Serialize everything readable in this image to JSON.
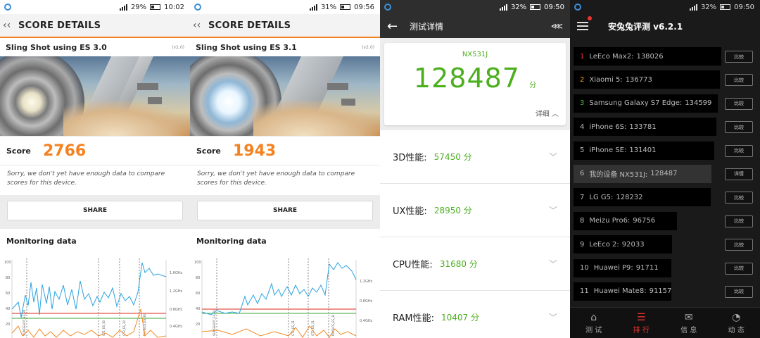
{
  "screen1": {
    "status": {
      "battery": "29%",
      "time": "10:02"
    },
    "title": "SCORE DETAILS",
    "test_name": "Sling Shot using ES 3.0",
    "version": "(v2.0)",
    "score_label": "Score",
    "score": "2766",
    "note": "Sorry, we don't yet have enough data to compare scores for this device.",
    "share": "SHARE",
    "monitoring": "Monitoring data",
    "chart_labels": {
      "y": [
        "100",
        "80",
        "60",
        "40",
        "20"
      ],
      "freq": [
        "1.6GHz",
        "1.2GHz",
        "0.8GHz",
        "0.4GHz"
      ],
      "markers": [
        "SLINGSHOT_ES_30",
        "GT1_ES_30",
        "GT2_ES_30",
        "PHYSICS_ES_30"
      ]
    }
  },
  "screen2": {
    "status": {
      "battery": "31%",
      "time": "09:56"
    },
    "title": "SCORE DETAILS",
    "test_name": "Sling Shot using ES 3.1",
    "version": "(v2.0)",
    "score_label": "Score",
    "score": "1943",
    "note": "Sorry, we don't yet have enough data to compare scores for this device.",
    "share": "SHARE",
    "monitoring": "Monitoring data",
    "chart_labels": {
      "y": [
        "100",
        "80",
        "60",
        "40",
        "20"
      ],
      "freq": [
        "1.2GHz",
        "0.8GHz",
        "0.4GHz"
      ],
      "markers": [
        "SLINGSHOT_ES_31",
        "GT1_ES_31",
        "GT2_ES_31",
        "PHYSICS_ES_31"
      ]
    }
  },
  "screen3": {
    "status": {
      "battery": "32%",
      "time": "09:50"
    },
    "title": "测试详情",
    "device": "NX531J",
    "total": "128487",
    "unit": "分",
    "more": "详细",
    "rows": [
      {
        "label": "3D性能:",
        "value": "57450 分"
      },
      {
        "label": "UX性能:",
        "value": "28950 分"
      },
      {
        "label": "CPU性能:",
        "value": "31680 分"
      },
      {
        "label": "RAM性能:",
        "value": "10407 分"
      }
    ]
  },
  "screen4": {
    "status": {
      "battery": "32%",
      "time": "09:50"
    },
    "title": "安兔兔评测 v6.2.1",
    "compare": "比较",
    "detail": "详情",
    "items": [
      {
        "rank": "1",
        "name": "LeEco Max2:",
        "score": "138026",
        "fraction": 1.0,
        "mine": false
      },
      {
        "rank": "2",
        "name": "Xiaomi 5:",
        "score": "136773",
        "fraction": 0.99,
        "mine": false
      },
      {
        "rank": "3",
        "name": "Samsung Galaxy S7 Edge:",
        "score": "134599",
        "fraction": 0.975,
        "mine": false
      },
      {
        "rank": "4",
        "name": "iPhone 6S:",
        "score": "133781",
        "fraction": 0.969,
        "mine": false
      },
      {
        "rank": "5",
        "name": "iPhone SE:",
        "score": "131401",
        "fraction": 0.952,
        "mine": false
      },
      {
        "rank": "6",
        "name": "我的设备 NX531J:",
        "score": "128487",
        "fraction": 0.931,
        "mine": true
      },
      {
        "rank": "7",
        "name": "LG G5:",
        "score": "128232",
        "fraction": 0.929,
        "mine": false
      },
      {
        "rank": "8",
        "name": "Meizu Pro6:",
        "score": "96756",
        "fraction": 0.701,
        "mine": false
      },
      {
        "rank": "9",
        "name": "LeEco 2:",
        "score": "92033",
        "fraction": 0.667,
        "mine": false
      },
      {
        "rank": "10",
        "name": "Huawei P9:",
        "score": "91711",
        "fraction": 0.664,
        "mine": false
      },
      {
        "rank": "11",
        "name": "Huawei Mate8:",
        "score": "91157",
        "fraction": 0.66,
        "mine": false
      }
    ],
    "nav": [
      "测 试",
      "排 行",
      "信 息",
      "动 态"
    ],
    "nav_active": 1
  }
}
